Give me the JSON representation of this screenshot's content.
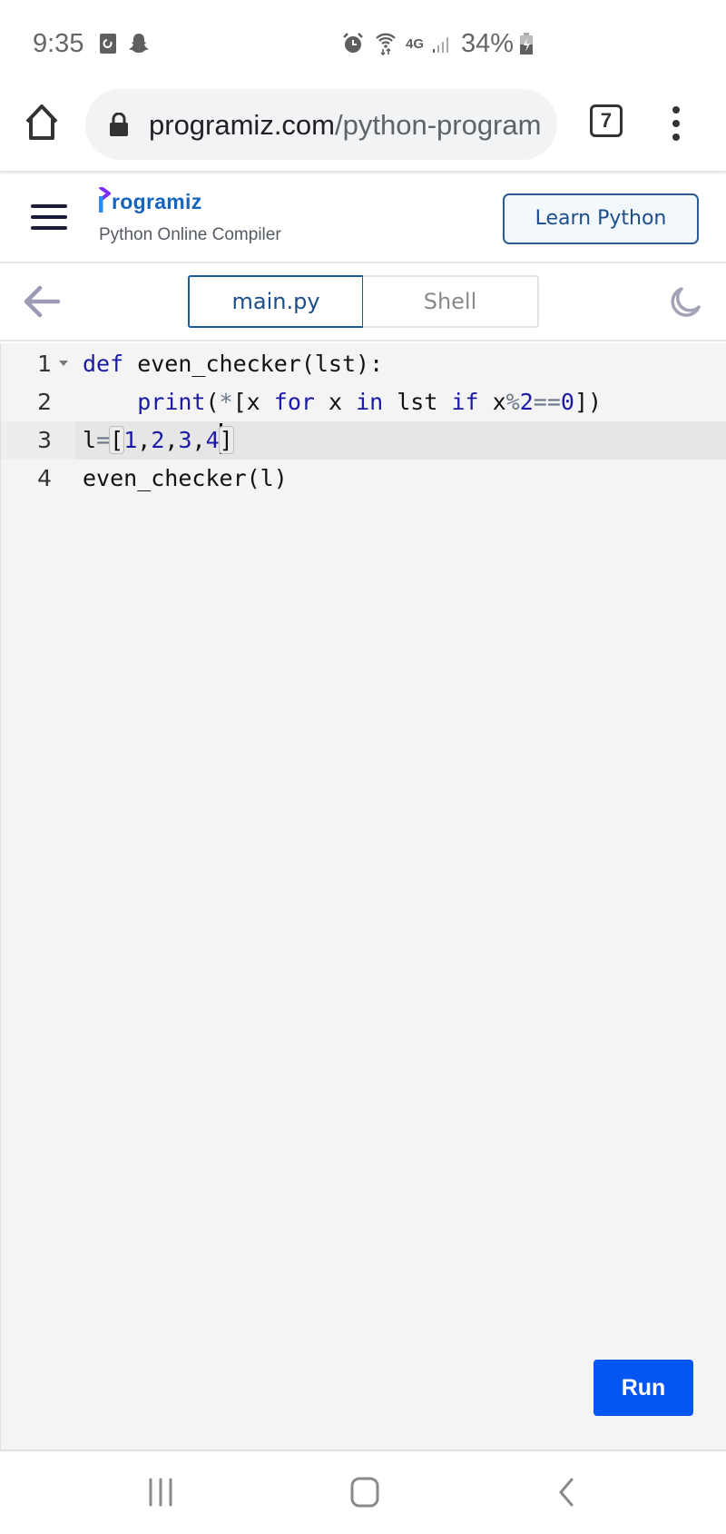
{
  "status_bar": {
    "time": "9:35",
    "left_icons": [
      "screen-recorder-icon",
      "snapchat-icon"
    ],
    "right_icons": [
      "alarm-icon",
      "wifi-icon",
      "4g-lte-icon",
      "signal-icon",
      "battery-charging-icon"
    ],
    "battery": "34%"
  },
  "browser": {
    "url_domain": "programiz.com",
    "url_path": "/python-program",
    "tab_count": "7"
  },
  "site_header": {
    "logo_text": "rogramiz",
    "subtitle": "Python Online Compiler",
    "learn_button": "Learn Python"
  },
  "toolbar": {
    "tabs": [
      {
        "label": "main.py",
        "active": true
      },
      {
        "label": "Shell",
        "active": false
      }
    ]
  },
  "editor": {
    "active_line": 3,
    "lines": [
      {
        "number": "1",
        "foldable": true,
        "text": "def even_checker(lst):"
      },
      {
        "number": "2",
        "foldable": false,
        "text": "    print(*[x for x in lst if x%2==0])"
      },
      {
        "number": "3",
        "foldable": false,
        "text": "l=[1,2,3,4]"
      },
      {
        "number": "4",
        "foldable": false,
        "text": "even_checker(l)"
      }
    ],
    "tokens": {
      "l1_kw": "def",
      "l1_rest": " even_checker(lst):",
      "l2_indent": "    ",
      "l2_print": "print",
      "l2_paren": "(",
      "l2_star": "*",
      "l2_a": "[x ",
      "l2_for": "for",
      "l2_b": " x ",
      "l2_in": "in",
      "l2_c": " lst ",
      "l2_if": "if",
      "l2_d": " x",
      "l2_mod": "%",
      "l2_two": "2",
      "l2_eq": "==",
      "l2_zero": "0",
      "l2_end": "])",
      "l3_var": "l",
      "l3_eq": "=",
      "l3_open": "[",
      "l3_n1": "1",
      "l3_c1": ",",
      "l3_n2": "2",
      "l3_c2": ",",
      "l3_n3": "3",
      "l3_c3": ",",
      "l3_n4": "4",
      "l3_close": "]",
      "l4": "even_checker(l)"
    },
    "run_button": "Run"
  },
  "colors": {
    "accent_blue": "#0556f3",
    "brand_blue": "#1c4e8c",
    "keyword": "#1a1aa6"
  }
}
